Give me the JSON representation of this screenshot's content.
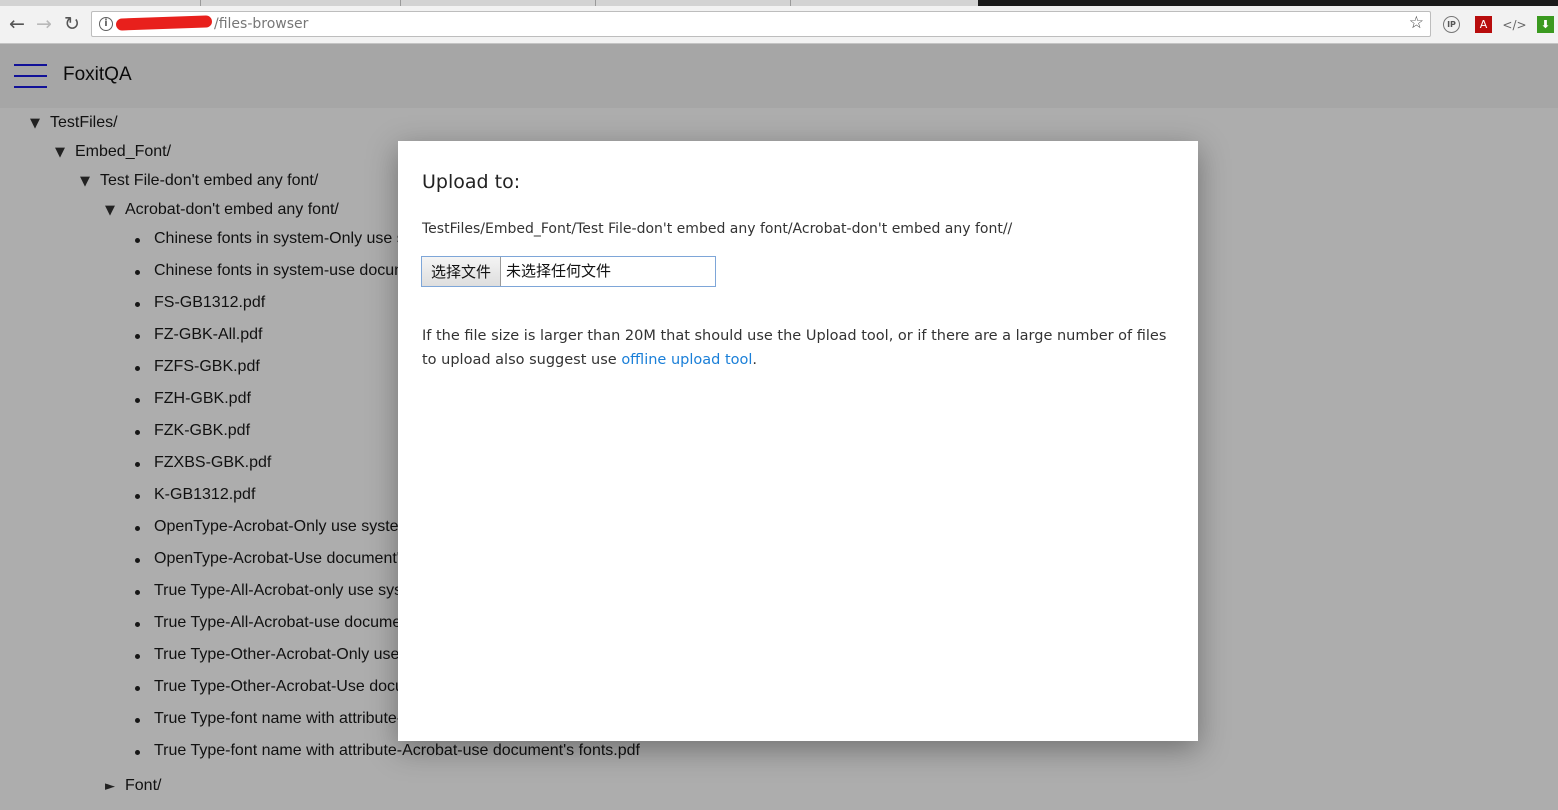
{
  "browser": {
    "url_suffix": "/files-browser",
    "icons": {
      "back": "back-arrow-icon",
      "forward": "forward-arrow-icon",
      "reload": "reload-icon",
      "info": "info-icon",
      "bookmark": "star-icon"
    },
    "extensions": [
      {
        "name": "ip-extension-icon",
        "glyph": "IP"
      },
      {
        "name": "acrobat-extension-icon",
        "glyph": "A"
      },
      {
        "name": "code-extension-icon",
        "glyph": "</>"
      },
      {
        "name": "download-extension-icon",
        "glyph": "⬇"
      }
    ]
  },
  "app": {
    "title": "FoxitQA",
    "accent_color": "#1a1ae0"
  },
  "tree": {
    "root": "TestFiles/",
    "level1": "Embed_Font/",
    "level2": "Test File-don't embed any font/",
    "level3": "Acrobat-don't embed any font/",
    "files": [
      "Chinese fonts in system-Only use system's fonts.pdf",
      "Chinese fonts in system-use document's fonts.pdf",
      "FS-GB1312.pdf",
      "FZ-GBK-All.pdf",
      "FZFS-GBK.pdf",
      "FZH-GBK.pdf",
      "FZK-GBK.pdf",
      "FZXBS-GBK.pdf",
      "K-GB1312.pdf",
      "OpenType-Acrobat-Only use system's fonts.pdf",
      "OpenType-Acrobat-Use document's fonts.pdf",
      "True Type-All-Acrobat-only use system's fonts.pdf",
      "True Type-All-Acrobat-use document's fonts.pdf",
      "True Type-Other-Acrobat-Only use system's fonts.pdf",
      "True Type-Other-Acrobat-Use document's fonts.pdf",
      "True Type-font name with attribute-Acrobat-only use system's fonts.pdf",
      "True Type-font name with attribute-Acrobat-use document's fonts.pdf"
    ],
    "sibling_folder": "Font/"
  },
  "modal": {
    "title": "Upload to:",
    "path": "TestFiles/Embed_Font/Test File-don't embed any font/Acrobat-don't embed any font//",
    "file_button_label": "选择文件",
    "file_status": "未选择任何文件",
    "note_text": "If the file size is larger than 20M that should use the Upload tool, or if there are a large number of files to upload also suggest use ",
    "note_link": "offline upload tool",
    "note_end": ".",
    "link_color": "#1a7fd8"
  }
}
